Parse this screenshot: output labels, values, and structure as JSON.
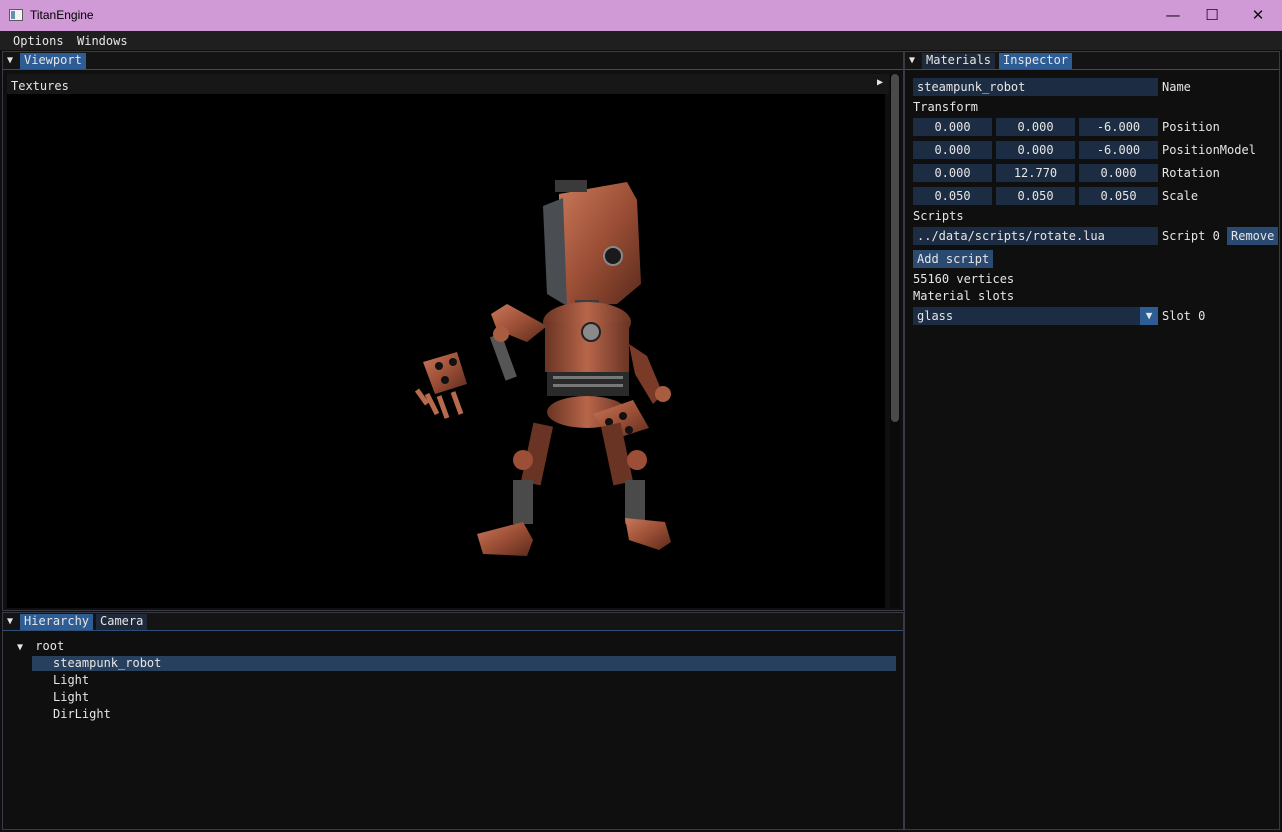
{
  "window": {
    "title": "TitanEngine"
  },
  "menu": {
    "items": [
      "Options",
      "Windows"
    ]
  },
  "viewport": {
    "tab": "Viewport",
    "sub_label": "Textures"
  },
  "hierarchy": {
    "tabs": [
      "Hierarchy",
      "Camera"
    ],
    "root": "root",
    "items": [
      "steampunk_robot",
      "Light",
      "Light",
      "DirLight"
    ]
  },
  "inspector": {
    "tabs": [
      "Materials",
      "Inspector"
    ],
    "name_value": "steampunk_robot",
    "name_label": "Name",
    "transform_label": "Transform",
    "rows": [
      {
        "values": [
          "0.000",
          "0.000",
          "-6.000"
        ],
        "label": "Position"
      },
      {
        "values": [
          "0.000",
          "0.000",
          "-6.000"
        ],
        "label": "PositionModel"
      },
      {
        "values": [
          "0.000",
          "12.770",
          "0.000"
        ],
        "label": "Rotation"
      },
      {
        "values": [
          "0.050",
          "0.050",
          "0.050"
        ],
        "label": "Scale"
      }
    ],
    "scripts_label": "Scripts",
    "script_path": "../data/scripts/rotate.lua",
    "script_label": "Script 0",
    "remove_label": "Remove",
    "add_script_label": "Add script",
    "vertices_text": "55160  vertices",
    "material_slots_label": "Material slots",
    "slot_value": "glass",
    "slot_label": "Slot 0"
  },
  "colors": {
    "title_bar": "#cf9ad5",
    "active_tab": "#2e5c94",
    "field_bg": "#1c2c42",
    "selection": "#26405e"
  }
}
